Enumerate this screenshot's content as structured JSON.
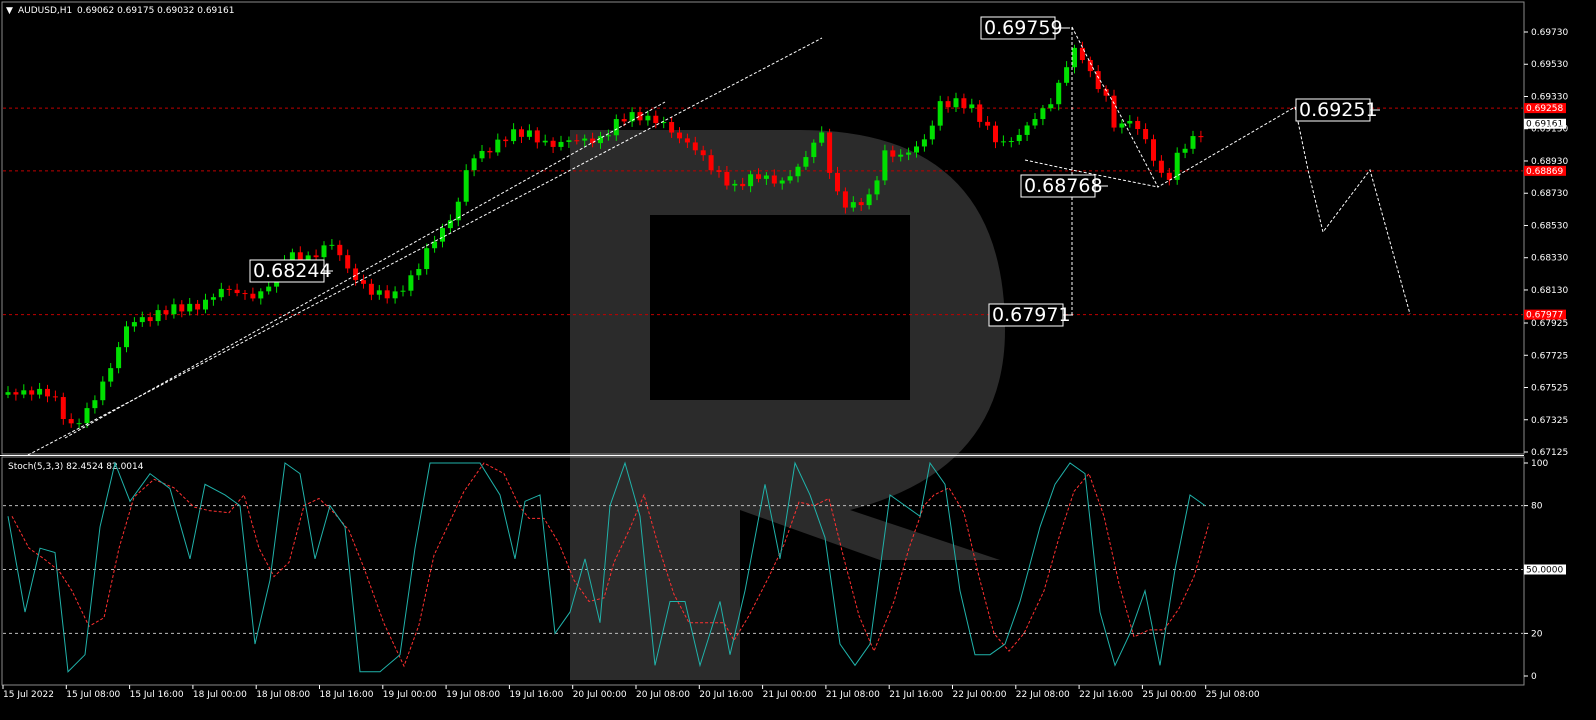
{
  "header": {
    "symbol_label": "AUDUSD,H1",
    "ohlc": "0.69062 0.69175 0.69032 0.69161",
    "indicator": "Stoch(5,3,3) 82.4524 82.0014"
  },
  "colors": {
    "bull": "#00e000",
    "bear": "#ff0000",
    "grid_red": "#c00000",
    "stoch_main": "#20b2aa",
    "stoch_signal": "#ff3030",
    "watermark": "#2b2b2b"
  },
  "chart_data": {
    "type": "candlestick",
    "symbol": "AUDUSD",
    "timeframe": "H1",
    "y_ticks": [
      "0.69730",
      "0.69530",
      "0.69330",
      "0.69130",
      "0.68930",
      "0.68730",
      "0.68530",
      "0.68330",
      "0.68130",
      "0.67925",
      "0.67725",
      "0.67525",
      "0.67325",
      "0.67125"
    ],
    "x_ticks": [
      "15 Jul 2022",
      "15 Jul 08:00",
      "15 Jul 16:00",
      "18 Jul 00:00",
      "18 Jul 08:00",
      "18 Jul 16:00",
      "19 Jul 00:00",
      "19 Jul 08:00",
      "19 Jul 16:00",
      "20 Jul 00:00",
      "20 Jul 08:00",
      "20 Jul 16:00",
      "21 Jul 00:00",
      "21 Jul 08:00",
      "21 Jul 16:00",
      "22 Jul 00:00",
      "22 Jul 08:00",
      "22 Jul 16:00",
      "25 Jul 00:00",
      "25 Jul 08:00"
    ],
    "horizontal_levels": [
      {
        "value": 0.69258,
        "tag": "0.69258"
      },
      {
        "value": 0.68869,
        "tag": "0.68869"
      },
      {
        "value": 0.67977,
        "tag": "0.67977"
      }
    ],
    "current_price": "0.69161",
    "annotations": [
      {
        "label": "0.69759",
        "value": 0.69759
      },
      {
        "label": "0.68768",
        "value": 0.68768
      },
      {
        "label": "0.67971",
        "value": 0.67971
      },
      {
        "label": "0.68244",
        "value": 0.68244
      },
      {
        "label": "0.69251",
        "value": 0.69251
      }
    ],
    "stochastic": {
      "name": "Stoch(5,3,3)",
      "main": 82.4524,
      "signal": 82.0014,
      "ticks": [
        "100",
        "80",
        "50.0000",
        "20",
        "0"
      ]
    }
  }
}
